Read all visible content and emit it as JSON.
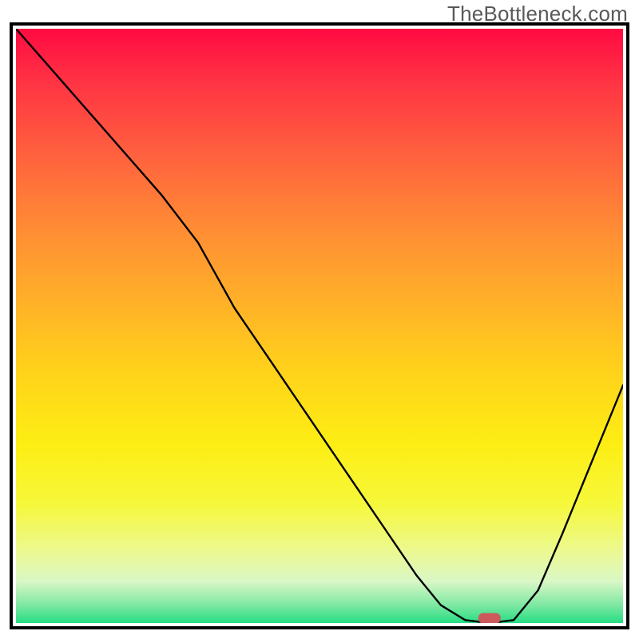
{
  "watermark": "TheBottleneck.com",
  "chart_data": {
    "type": "line",
    "title": "",
    "xlabel": "",
    "ylabel": "",
    "xlim": [
      0,
      100
    ],
    "ylim": [
      0,
      100
    ],
    "grid": false,
    "legend": false,
    "background_gradient": {
      "top_color": "#ff0a42",
      "mid_color": "#ffd31a",
      "bottom_color": "#26dd84"
    },
    "series": [
      {
        "name": "bottleneck-curve",
        "x": [
          0,
          6,
          12,
          18,
          24,
          30,
          36,
          42,
          48,
          54,
          60,
          66,
          70,
          74,
          78,
          82,
          86,
          90,
          94,
          98,
          100
        ],
        "values": [
          100,
          93,
          86,
          79,
          72,
          64,
          53,
          44,
          35,
          26,
          17,
          8,
          3,
          0.5,
          0,
          0.5,
          5.5,
          15,
          25,
          35,
          40
        ]
      }
    ],
    "marker": {
      "name": "optimal-point",
      "x": 78,
      "y": 0.8,
      "color": "#cc5a5c",
      "shape": "pill"
    }
  }
}
